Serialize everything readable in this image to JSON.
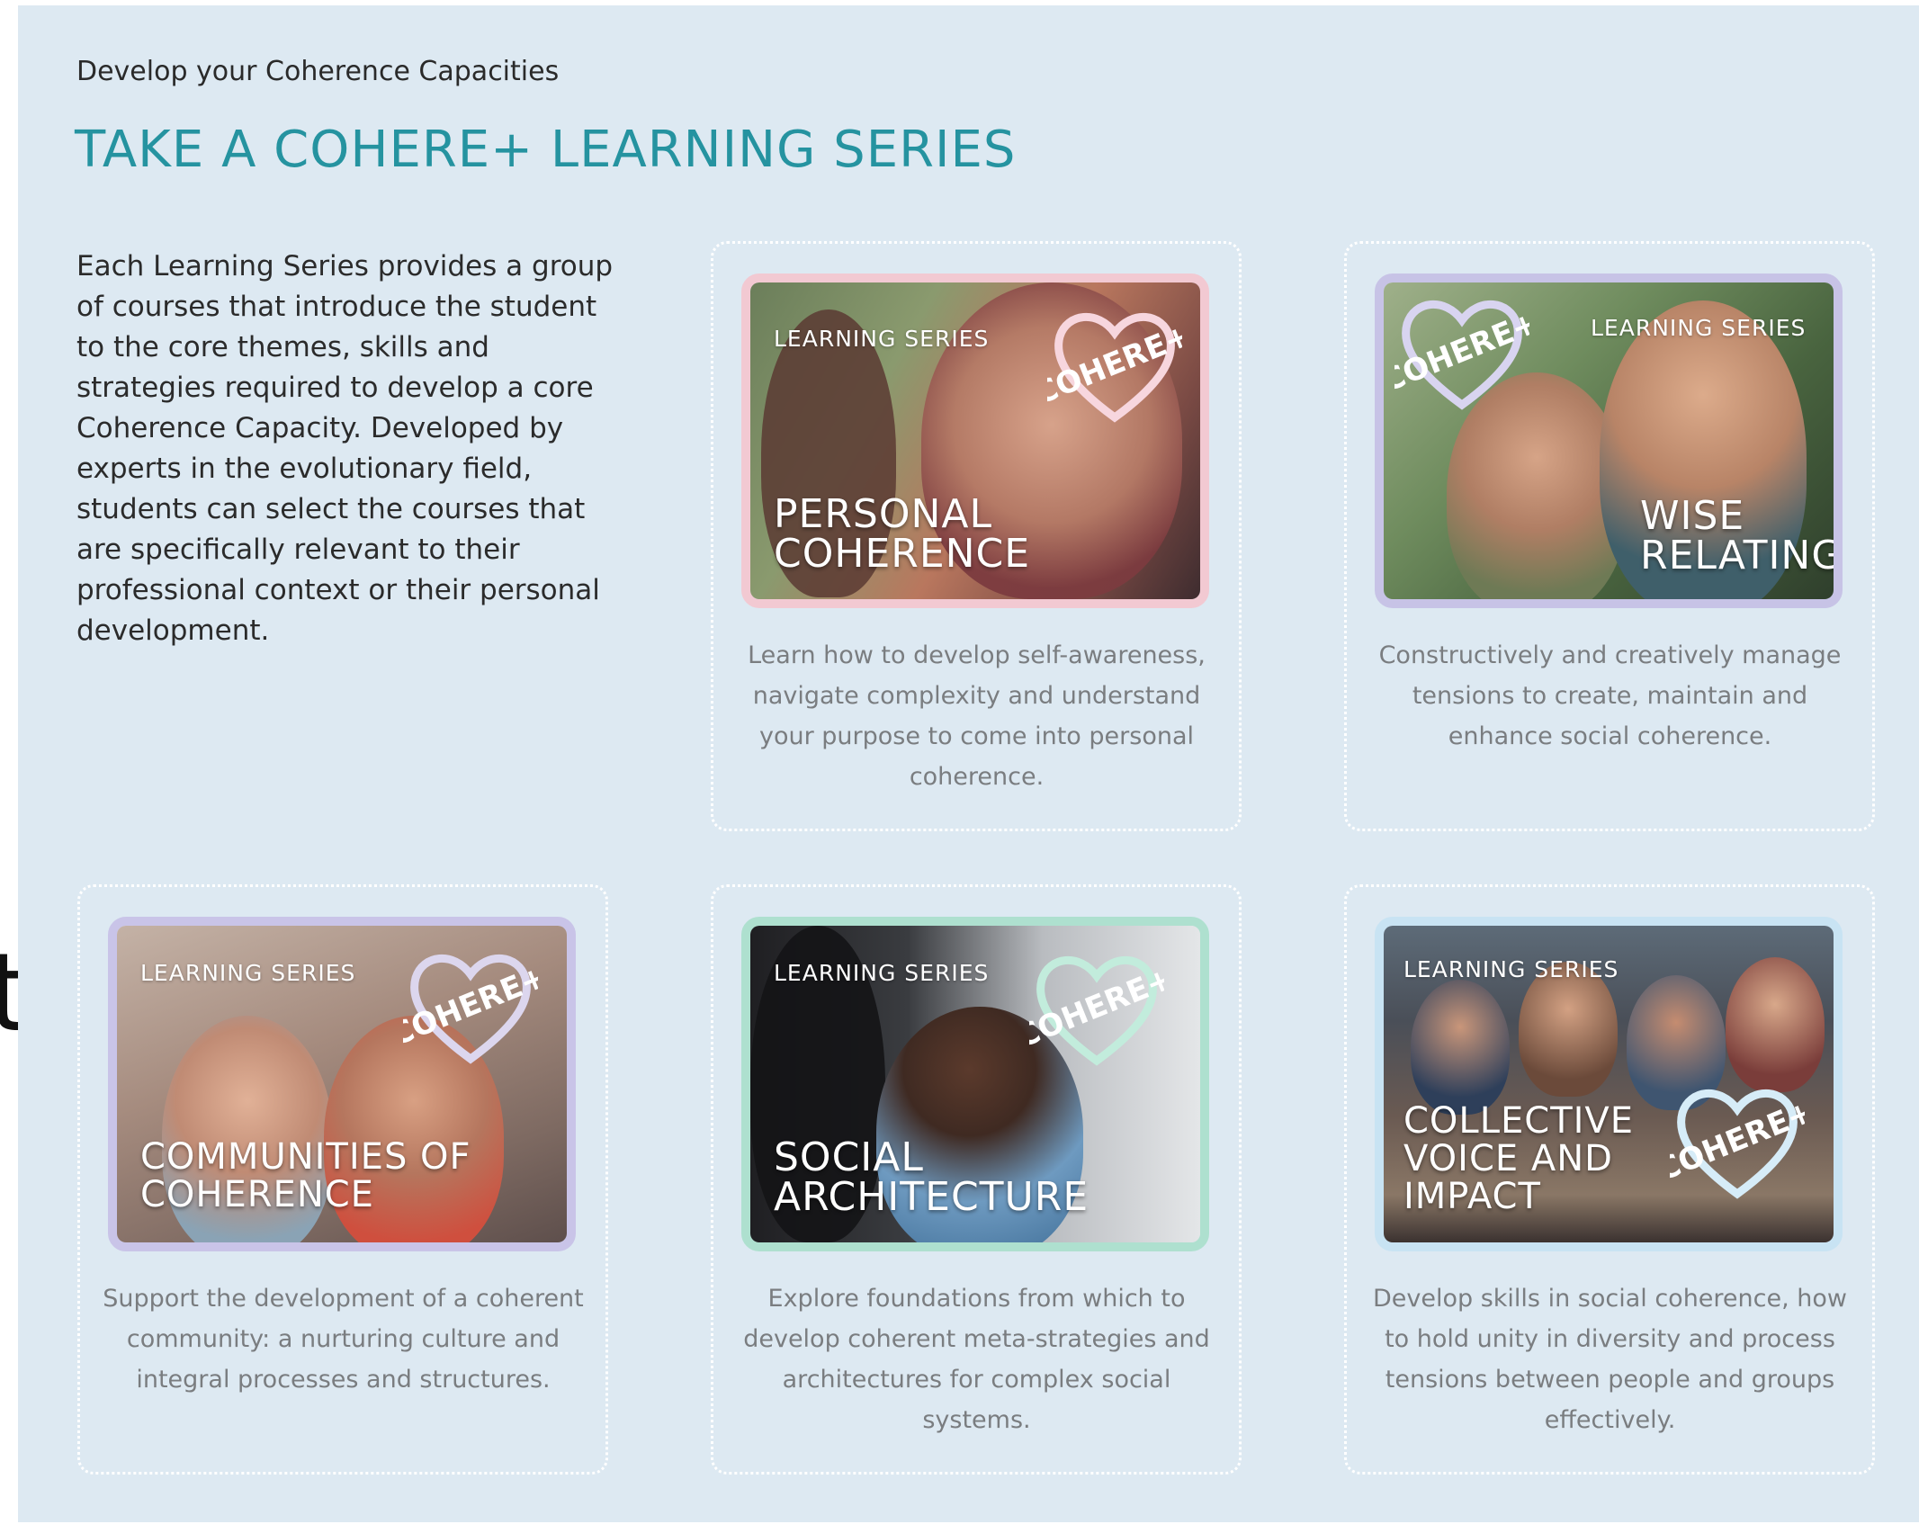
{
  "edge_glyph": "t",
  "section": {
    "eyebrow": "Develop your Coherence Capacities",
    "heading": "TAKE A COHERE+ LEARNING SERIES",
    "intro": "Each Learning Series provides a group of courses that introduce the student to the core themes, skills and strategies required to develop a core Coherence Capacity. Developed by experts in the evolutionary field, students can select the courses that are specifically relevant to their professional context or their personal development."
  },
  "logo_text": "COHERE+",
  "cards": [
    {
      "tag": "LEARNING SERIES",
      "title": "PERSONAL\nCOHERENCE",
      "description": "Learn how to develop self-awareness, navigate complexity and understand your purpose to come into personal coherence.",
      "frame_color": "#f2c9d2"
    },
    {
      "tag": "LEARNING SERIES",
      "title": "WISE\nRELATING",
      "description": "Constructively and creatively manage tensions to create, maintain and enhance social coherence.",
      "frame_color": "#c7c3e6"
    },
    {
      "tag": "LEARNING SERIES",
      "title": "COMMUNITIES OF\nCOHERENCE",
      "description": "Support the development of a coherent community: a nurturing culture and integral processes and structures.",
      "frame_color": "#c9c4e8"
    },
    {
      "tag": "LEARNING SERIES",
      "title": "SOCIAL\nARCHITECTURE",
      "description": "Explore foundations from which to develop coherent meta-strategies and architectures for complex social systems.",
      "frame_color": "#aee0cf"
    },
    {
      "tag": "LEARNING SERIES",
      "title": "COLLECTIVE\nVOICE AND\nIMPACT",
      "description": "Develop skills in social coherence, how to hold unity in diversity and process tensions between people and groups effectively.",
      "frame_color": "#c8e3f3"
    }
  ]
}
